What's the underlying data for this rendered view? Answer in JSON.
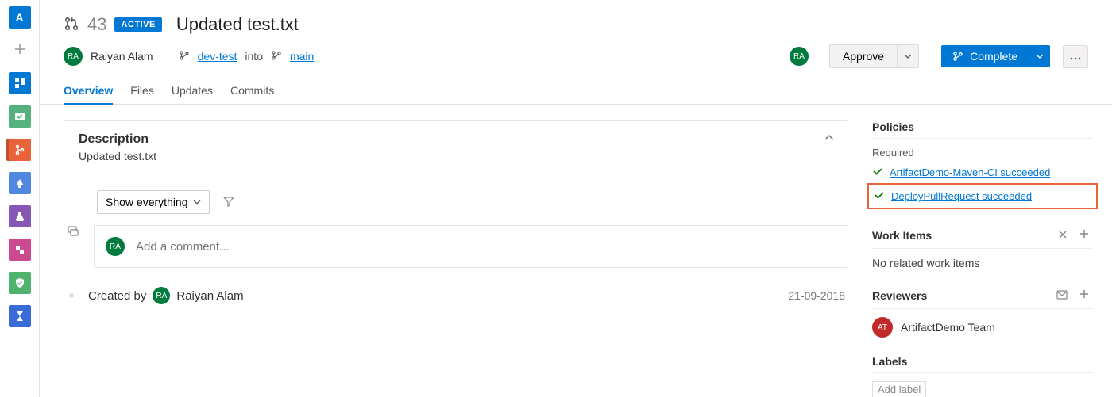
{
  "rail": {
    "logo": "A"
  },
  "pr": {
    "id": "43",
    "status": "ACTIVE",
    "title": "Updated test.txt",
    "author_initials": "RA",
    "author_name": "Raiyan Alam",
    "source_branch": "dev-test",
    "into": "into",
    "target_branch": "main"
  },
  "buttons": {
    "approve": "Approve",
    "complete": "Complete"
  },
  "tabs": {
    "overview": "Overview",
    "files": "Files",
    "updates": "Updates",
    "commits": "Commits"
  },
  "description": {
    "heading": "Description",
    "body": "Updated test.txt"
  },
  "filter": {
    "label": "Show everything"
  },
  "comment": {
    "placeholder": "Add a comment...",
    "self_initials": "RA"
  },
  "created": {
    "prefix": "Created by",
    "initials": "RA",
    "name": "Raiyan Alam",
    "date": "21-09-2018"
  },
  "side": {
    "policies": {
      "title": "Policies",
      "required_label": "Required",
      "items": [
        "ArtifactDemo-Maven-CI succeeded",
        "DeployPullRequest succeeded"
      ]
    },
    "workitems": {
      "title": "Work Items",
      "empty": "No related work items"
    },
    "reviewers": {
      "title": "Reviewers",
      "items": [
        {
          "initials": "AT",
          "name": "ArtifactDemo Team"
        }
      ]
    },
    "labels": {
      "title": "Labels",
      "placeholder": "Add label"
    }
  }
}
